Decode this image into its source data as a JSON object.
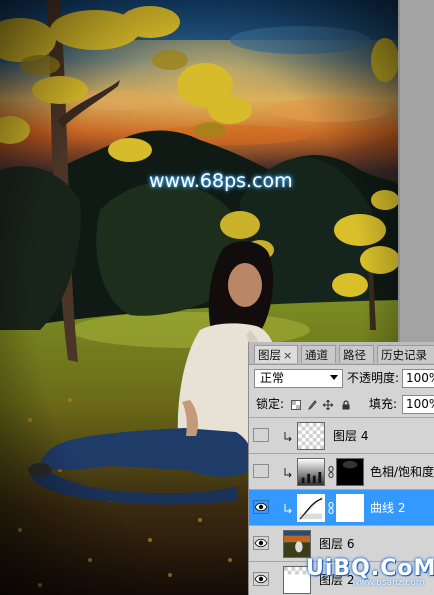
{
  "photo": {
    "watermark": "www.68ps.com",
    "colors": {
      "sky_top": "#1c4c7e",
      "sunset": "#d96a20",
      "foliage_yellow": "#e7c52a",
      "dark_trees": "#0c1410",
      "grass": "#8a9a2a"
    }
  },
  "panel": {
    "tabs": [
      {
        "label": "图层",
        "close": "×",
        "active": true
      },
      {
        "label": "通道",
        "active": false
      },
      {
        "label": "路径",
        "active": false
      },
      {
        "label": "历史记录",
        "active": false
      }
    ],
    "blend_mode": "正常",
    "opacity_label": "不透明度:",
    "opacity_value": "100%",
    "lock_label": "锁定:",
    "fill_label": "填充:",
    "fill_value": "100%",
    "layers": [
      {
        "name": "图层 4",
        "visible": false,
        "selected": false,
        "type": "pixel-transparent"
      },
      {
        "name": "色相/饱和度",
        "visible": false,
        "selected": false,
        "type": "adjustment-hue"
      },
      {
        "name": "曲线 2",
        "visible": true,
        "selected": true,
        "type": "adjustment-curves"
      },
      {
        "name": "图层 6",
        "visible": true,
        "selected": false,
        "type": "pixel-photo"
      },
      {
        "name": "图层 2",
        "visible": true,
        "selected": false,
        "type": "pixel-transparent"
      }
    ],
    "accent": "#3399ff"
  },
  "stamp": {
    "logo": "UiBQ.CoM",
    "url": "www.psanz.com"
  }
}
